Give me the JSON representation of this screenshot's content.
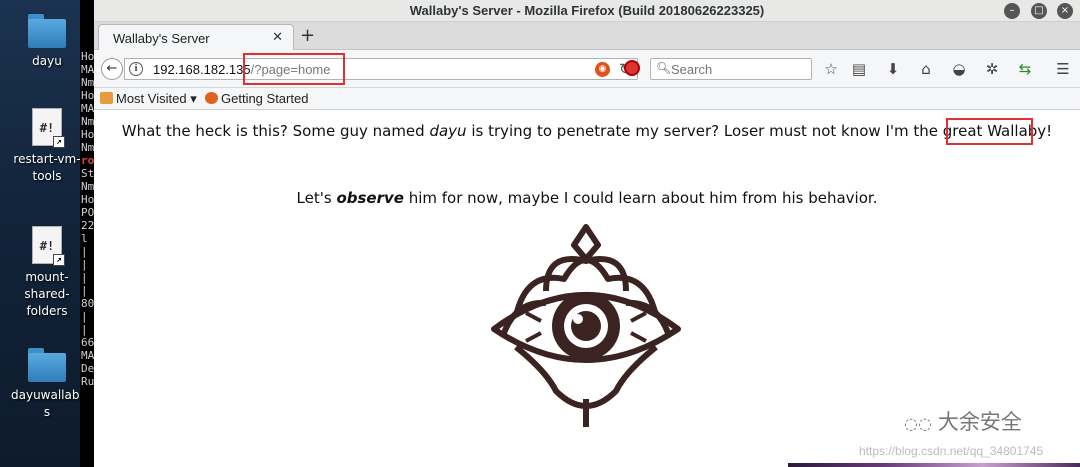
{
  "desktop": {
    "icons": [
      {
        "label": "dayu",
        "type": "folder"
      },
      {
        "label": "restart-vm-tools",
        "type": "script"
      },
      {
        "label": "mount-shared-folders",
        "type": "script"
      },
      {
        "label": "dayuwallaby s",
        "type": "folder"
      }
    ]
  },
  "terminal": {
    "lines": [
      "Ho",
      "MA",
      "Nm",
      "Ho",
      "MA",
      "Nm",
      "Ho",
      "Nm",
      "ro",
      "St",
      "Nm",
      "Ho",
      "PO",
      "22",
      "l",
      "|",
      "|",
      "|",
      "|",
      "80",
      "|",
      "|",
      "66",
      "MA",
      "De",
      "Ru"
    ]
  },
  "window": {
    "title": "Wallaby's Server - Mozilla Firefox (Build 20180626223325)",
    "tab_label": "Wallaby's Server",
    "url_host": "192.168.182.135",
    "url_path": "/?page=home",
    "search_placeholder": "Search",
    "bookmarks": [
      "Most Visited",
      "Getting Started"
    ]
  },
  "page": {
    "line1_before": "What the heck is this? Some guy named ",
    "line1_name": "dayu",
    "line1_middle": " is trying to penetrate my server? Loser must not know I'm the great ",
    "line1_end": "Wallaby!",
    "line2_before": "Let's ",
    "line2_em": "observe",
    "line2_after": " him for now, maybe I could learn about him from his behavior."
  },
  "watermark": {
    "brand": "大余安全",
    "url": "https://blog.csdn.net/qq_34801745"
  },
  "colors": {
    "highlight_box": "#e03030",
    "eye_ink": "#3b2322"
  }
}
